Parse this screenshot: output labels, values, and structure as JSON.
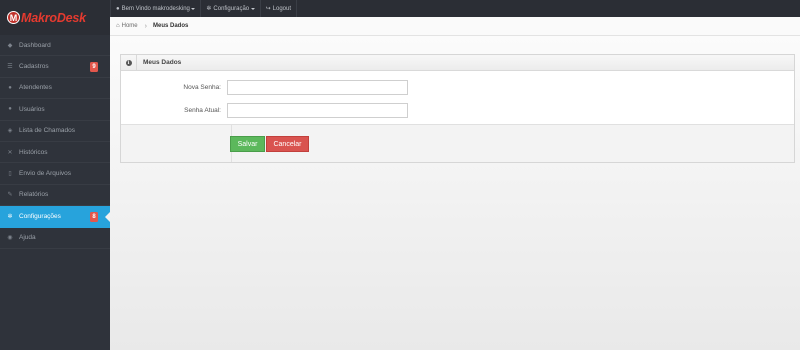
{
  "brand": {
    "logo_letter": "M",
    "name": "MakroDesk"
  },
  "topnav": {
    "welcome": "Bem Vindo makrodesking",
    "settings": "Configuração",
    "logout": "Logout"
  },
  "sidebar": {
    "items": [
      {
        "label": "Dashboard",
        "icon": "dashboard-icon",
        "glyph": "◆"
      },
      {
        "label": "Cadastros",
        "icon": "list-icon",
        "glyph": "☰",
        "badge": "9"
      },
      {
        "label": "Atendentes",
        "icon": "users-icon",
        "glyph": "●"
      },
      {
        "label": "Usuários",
        "icon": "users-icon",
        "glyph": "●"
      },
      {
        "label": "Lista de Chamados",
        "icon": "tags-icon",
        "glyph": "◈"
      },
      {
        "label": "Históricos",
        "icon": "tools-icon",
        "glyph": "✕"
      },
      {
        "label": "Envio de Arquivos",
        "icon": "file-icon",
        "glyph": "▯"
      },
      {
        "label": "Relatórios",
        "icon": "pencil-icon",
        "glyph": "✎"
      },
      {
        "label": "Configurações",
        "icon": "gear-icon",
        "glyph": "✲",
        "badge": "8",
        "active": true
      },
      {
        "label": "Ajuda",
        "icon": "eye-icon",
        "glyph": "◉"
      }
    ]
  },
  "breadcrumb": {
    "home": "Home",
    "current": "Meus Dados"
  },
  "panel": {
    "title": "Meus Dados",
    "fields": [
      {
        "label": "Nova Senha:",
        "value": ""
      },
      {
        "label": "Senha Atual:",
        "value": ""
      }
    ],
    "save_label": "Salvar",
    "cancel_label": "Cancelar"
  },
  "colors": {
    "accent": "#27a3dc",
    "badge": "#e2574c",
    "save": "#5cb85c",
    "cancel": "#d9534f",
    "brand": "#e53a2f"
  }
}
